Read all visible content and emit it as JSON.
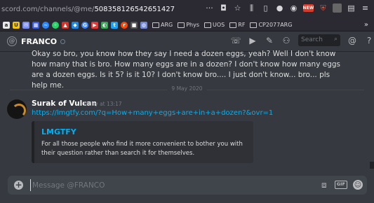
{
  "browser": {
    "url_prefix": "scord.com/channels/@me/",
    "url_id": "508358126542651427",
    "bookmark_folders": [
      "ARG",
      "Phys",
      "UOS",
      "RF",
      "CP2077ARG"
    ],
    "extension_badge": "NEW"
  },
  "header": {
    "dm_name": "FRANCO",
    "search_placeholder": "Search"
  },
  "messages": {
    "previous_text": "Okay so bro, you know how they say I need a dozen eggs, yeah? Well I don't know how many that is bro. How many eggs are in a dozen? I don't know how many eggs are a dozen eggs. Is it 5? is it 10? I don't know bro.... I just don't know... bro... pls help me.",
    "date_divider": "9 May 2020",
    "author": "Surak of Vulcan",
    "timestamp": "Today at 13:17",
    "link": "https://lmgtfy.com/?q=How+many+eggs+are+in+a+dozen?&ovr=1",
    "embed": {
      "title": "LMGTFY",
      "description": "For all those people who find it more convenient to bother you with their question rather than search it for themselves."
    }
  },
  "composer": {
    "placeholder": "Message @FRANCO",
    "gif_label": "GIF"
  },
  "colors": {
    "background": "#36393f",
    "link": "#00b0f4",
    "embed_bg": "#2f3136"
  }
}
